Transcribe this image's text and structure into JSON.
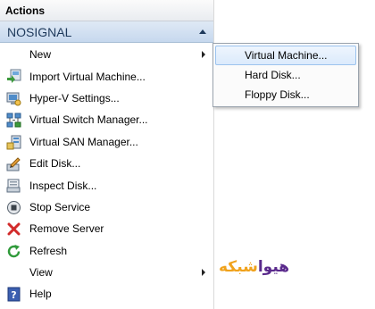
{
  "pane": {
    "title": "Actions"
  },
  "section": {
    "title": "NOSIGNAL"
  },
  "menu": {
    "new": "New",
    "import_vm": "Import Virtual Machine...",
    "hyperv_settings": "Hyper-V Settings...",
    "virtual_switch_manager": "Virtual Switch Manager...",
    "virtual_san_manager": "Virtual SAN Manager...",
    "edit_disk": "Edit Disk...",
    "inspect_disk": "Inspect Disk...",
    "stop_service": "Stop Service",
    "remove_server": "Remove Server",
    "refresh": "Refresh",
    "view": "View",
    "help": "Help"
  },
  "submenu": {
    "virtual_machine": "Virtual Machine...",
    "hard_disk": "Hard Disk...",
    "floppy_disk": "Floppy Disk..."
  },
  "watermark": {
    "part1": "هیوا",
    "part2": "شبکه"
  },
  "colors": {
    "section_text": "#1e395b",
    "highlight_border": "#9cc3ee",
    "watermark_purple": "#5a2a8c",
    "watermark_orange": "#f0a21c"
  }
}
